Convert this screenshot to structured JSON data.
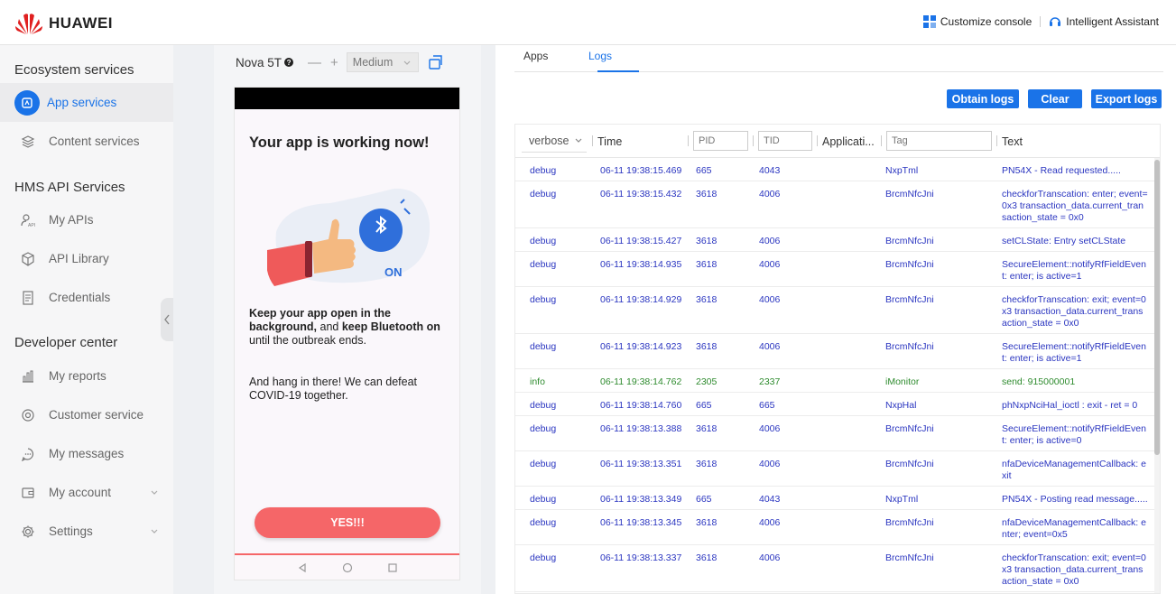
{
  "brand": {
    "name": "HUAWEI"
  },
  "header": {
    "customize": "Customize console",
    "assistant": "Intelligent Assistant"
  },
  "sidebar": {
    "ecosystem_title": "Ecosystem services",
    "app_services": "App services",
    "content_services": "Content services",
    "hms_title": "HMS API Services",
    "my_apis": "My APIs",
    "api_library": "API Library",
    "credentials": "Credentials",
    "dev_title": "Developer center",
    "my_reports": "My reports",
    "customer_service": "Customer service",
    "my_messages": "My messages",
    "my_account": "My account",
    "settings": "Settings"
  },
  "device": {
    "name": "Nova 5T",
    "minus": "—",
    "plus": "+",
    "size": "Medium"
  },
  "app_screen": {
    "heading": "Your app is working now!",
    "on_label": "ON",
    "p1_bold1": "Keep your app open in the background,",
    "p1_text1": " and ",
    "p1_bold2": "keep Bluetooth on",
    "p1_text2": " until the outbreak ends.",
    "p2": "And hang in there! We can defeat COVID-19 together.",
    "button": "YES!!!"
  },
  "tabs": {
    "apps": "Apps",
    "logs": "Logs"
  },
  "actions": {
    "obtain": "Obtain logs",
    "clear": "Clear",
    "export": "Export logs"
  },
  "log_header": {
    "level": "verbose",
    "time": "Time",
    "pid_placeholder": "PID",
    "tid_placeholder": "TID",
    "application": "Applicati...",
    "tag_placeholder": "Tag",
    "text": "Text"
  },
  "logs": [
    {
      "level": "debug",
      "time": "06-11 19:38:15.469",
      "pid": "665",
      "tid": "4043",
      "tag": "NxpTml",
      "text": "PN54X - Read requested....."
    },
    {
      "level": "debug",
      "time": "06-11 19:38:15.432",
      "pid": "3618",
      "tid": "4006",
      "tag": "BrcmNfcJni",
      "text": "checkforTranscation: enter; event=0x3 transaction_data.current_transaction_state = 0x0"
    },
    {
      "level": "debug",
      "time": "06-11 19:38:15.427",
      "pid": "3618",
      "tid": "4006",
      "tag": "BrcmNfcJni",
      "text": "setCLState: Entry setCLState"
    },
    {
      "level": "debug",
      "time": "06-11 19:38:14.935",
      "pid": "3618",
      "tid": "4006",
      "tag": "BrcmNfcJni",
      "text": "SecureElement::notifyRfFieldEvent: enter; is active=1"
    },
    {
      "level": "debug",
      "time": "06-11 19:38:14.929",
      "pid": "3618",
      "tid": "4006",
      "tag": "BrcmNfcJni",
      "text": "checkforTranscation: exit; event=0x3 transaction_data.current_transaction_state = 0x0"
    },
    {
      "level": "debug",
      "time": "06-11 19:38:14.923",
      "pid": "3618",
      "tid": "4006",
      "tag": "BrcmNfcJni",
      "text": "SecureElement::notifyRfFieldEvent: enter; is active=1"
    },
    {
      "level": "info",
      "time": "06-11 19:38:14.762",
      "pid": "2305",
      "tid": "2337",
      "tag": "iMonitor",
      "text": "send: 915000001"
    },
    {
      "level": "debug",
      "time": "06-11 19:38:14.760",
      "pid": "665",
      "tid": "665",
      "tag": "NxpHal",
      "text": "phNxpNciHal_ioctl : exit - ret = 0"
    },
    {
      "level": "debug",
      "time": "06-11 19:38:13.388",
      "pid": "3618",
      "tid": "4006",
      "tag": "BrcmNfcJni",
      "text": "SecureElement::notifyRfFieldEvent: enter; is active=0"
    },
    {
      "level": "debug",
      "time": "06-11 19:38:13.351",
      "pid": "3618",
      "tid": "4006",
      "tag": "BrcmNfcJni",
      "text": "nfaDeviceManagementCallback: exit"
    },
    {
      "level": "debug",
      "time": "06-11 19:38:13.349",
      "pid": "665",
      "tid": "4043",
      "tag": "NxpTml",
      "text": "PN54X - Posting read message....."
    },
    {
      "level": "debug",
      "time": "06-11 19:38:13.345",
      "pid": "3618",
      "tid": "4006",
      "tag": "BrcmNfcJni",
      "text": "nfaDeviceManagementCallback: enter; event=0x5"
    },
    {
      "level": "debug",
      "time": "06-11 19:38:13.337",
      "pid": "3618",
      "tid": "4006",
      "tag": "BrcmNfcJni",
      "text": "checkforTranscation: exit; event=0x3 transaction_data.current_transaction_state = 0x0"
    }
  ],
  "colors": {
    "accent": "#1a73e8",
    "brand_red": "#e02020",
    "button_red": "#f56668",
    "debug": "#2a35c0",
    "info": "#2e8b2e"
  }
}
